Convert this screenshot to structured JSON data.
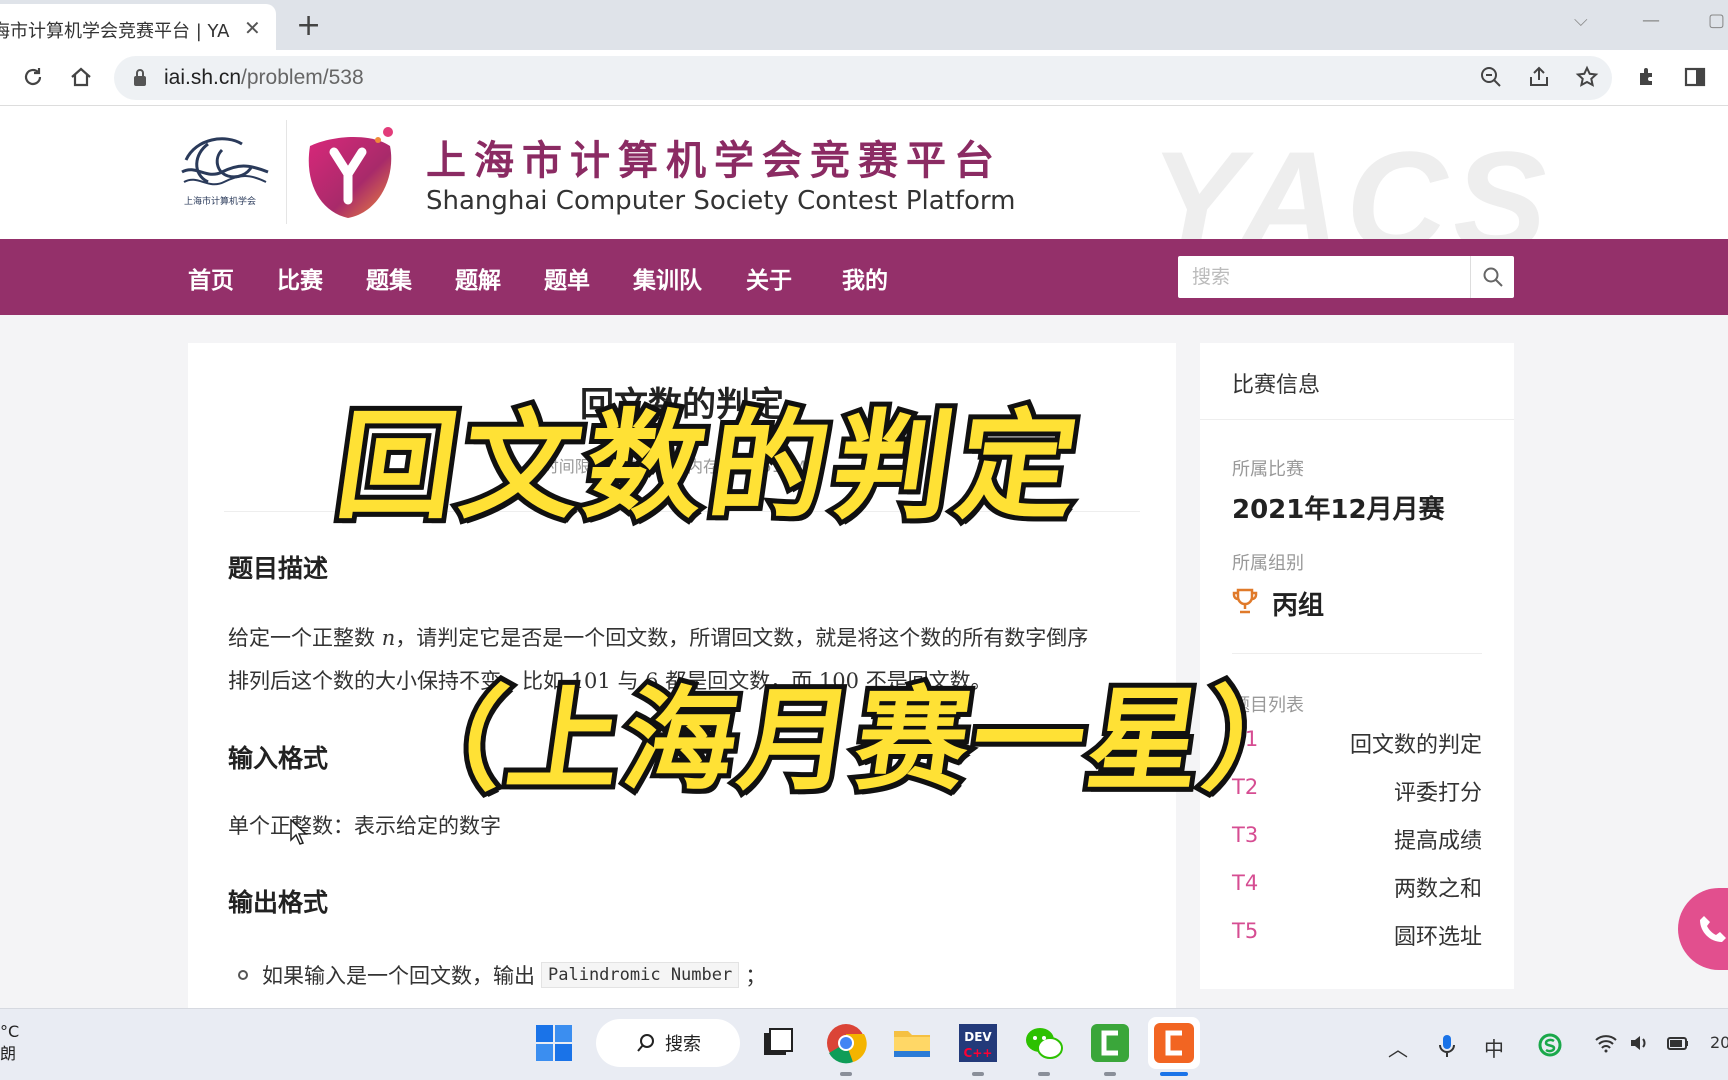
{
  "browser": {
    "tab_title": "海市计算机学会竞赛平台 | YACS",
    "tab_close": "✕",
    "new_tab": "+",
    "url_host": "iai.sh.cn",
    "url_path": "/problem/538"
  },
  "site": {
    "society_logo_text": "上海市计算机学会",
    "title_cn": "上海市计算机学会竞赛平台",
    "title_en": "Shanghai Computer Society Contest Platform",
    "watermark": "YACS",
    "brand_color": "#94306a"
  },
  "nav": {
    "items": [
      "首页",
      "比赛",
      "题集",
      "题解",
      "题单",
      "集训队",
      "关于",
      "我的"
    ],
    "search_placeholder": "搜索"
  },
  "problem": {
    "title": "回文数的判定",
    "meta": "时间限制: 2500ms   内存限制: 512MiB",
    "sections": {
      "description_title": "题目描述",
      "description_line1_a": "给定一个正整数",
      "description_var": "n",
      "description_line1_b": "，请判定它是否是一个回文数，所谓回文数，就是将这个数的所有数字倒序",
      "description_line2_a": "排列后这个数的大小保持不变，比如",
      "description_num1": "101",
      "description_line2_b": "与",
      "description_num2": "6",
      "description_line2_c": "都是回文数，而",
      "description_num3": "100",
      "description_line2_d": "不是回文数。",
      "input_title": "输入格式",
      "input_text": "单个正整数：表示给定的数字",
      "output_title": "输出格式",
      "output_bullet_a": "如果输入是一个回文数，输出",
      "output_code": "Palindromic Number",
      "output_bullet_b": "；"
    }
  },
  "contest_info": {
    "heading": "比赛信息",
    "contest_label": "所属比赛",
    "contest_value": "2021年12月月赛",
    "group_label": "所属组别",
    "group_value": "丙组",
    "tasks_label": "题目列表",
    "tasks": [
      {
        "id": "T1",
        "name": "回文数的判定"
      },
      {
        "id": "T2",
        "name": "评委打分"
      },
      {
        "id": "T3",
        "name": "提高成绩"
      },
      {
        "id": "T4",
        "name": "两数之和"
      },
      {
        "id": "T5",
        "name": "圆环选址"
      }
    ]
  },
  "overlay": {
    "caption_line1": "回文数的判定",
    "caption_line2": "（上海月赛一星）",
    "caption_color": "#ffe135"
  },
  "taskbar": {
    "weather_temp": "°C",
    "weather_desc": "朗",
    "search_label": "搜索",
    "clock": "20"
  }
}
